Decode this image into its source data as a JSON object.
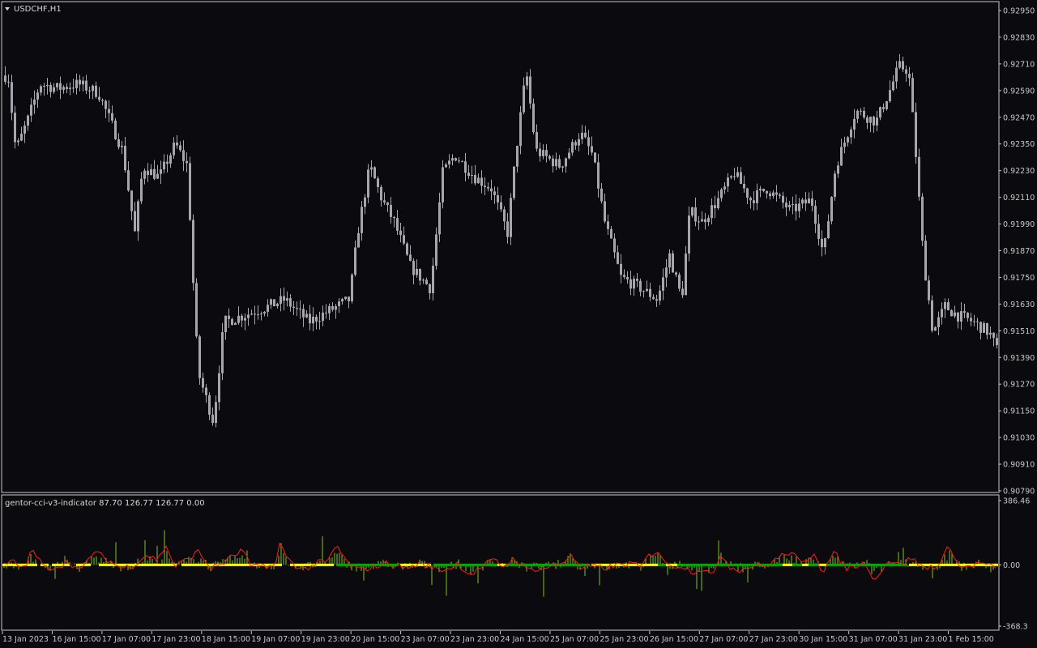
{
  "symbol_label": "USDCHF,H1",
  "indicator_label": "gentor-cci-v3-indicator 87.70 126.77 126.77 0.00",
  "colors": {
    "background": "#0b0b0f",
    "frame": "#c8c8c8",
    "candle": "#a6a6ac",
    "bullish_hist": "#7fc31c",
    "cci_line": "#ff1a1a",
    "trend_up": "#00aa00",
    "trend_down": "#ffff00",
    "axis_text": "#c8c8c8"
  },
  "chart_data": [
    {
      "type": "candlestick",
      "title": "USDCHF,H1",
      "ylim": [
        0.9079,
        0.9295
      ],
      "y_ticks": [
        "0.92950",
        "0.92830",
        "0.92710",
        "0.92590",
        "0.92470",
        "0.92350",
        "0.92230",
        "0.92110",
        "0.91990",
        "0.91870",
        "0.91750",
        "0.91630",
        "0.91510",
        "0.91390",
        "0.91270",
        "0.91150",
        "0.91030",
        "0.90910",
        "0.90790"
      ],
      "x_ticks": [
        "13 Jan 2023",
        "16 Jan 15:00",
        "17 Jan 07:00",
        "17 Jan 23:00",
        "18 Jan 15:00",
        "19 Jan 07:00",
        "19 Jan 23:00",
        "20 Jan 15:00",
        "23 Jan 07:00",
        "23 Jan 23:00",
        "24 Jan 15:00",
        "25 Jan 07:00",
        "25 Jan 23:00",
        "26 Jan 15:00",
        "27 Jan 07:00",
        "27 Jan 23:00",
        "30 Jan 15:00",
        "31 Jan 07:00",
        "31 Jan 23:00",
        "1 Feb 15:00"
      ],
      "close_path": [
        [
          0,
          0.9262
        ],
        [
          8,
          0.9268
        ],
        [
          18,
          0.9232
        ],
        [
          32,
          0.9245
        ],
        [
          48,
          0.9262
        ],
        [
          70,
          0.926
        ],
        [
          95,
          0.9262
        ],
        [
          120,
          0.9258
        ],
        [
          135,
          0.9245
        ],
        [
          150,
          0.9232
        ],
        [
          165,
          0.9195
        ],
        [
          175,
          0.9225
        ],
        [
          195,
          0.922
        ],
        [
          215,
          0.9235
        ],
        [
          230,
          0.9225
        ],
        [
          240,
          0.915
        ],
        [
          245,
          0.913
        ],
        [
          262,
          0.911
        ],
        [
          275,
          0.9155
        ],
        [
          300,
          0.9158
        ],
        [
          330,
          0.9162
        ],
        [
          350,
          0.9165
        ],
        [
          380,
          0.9155
        ],
        [
          405,
          0.916
        ],
        [
          430,
          0.9165
        ],
        [
          440,
          0.9195
        ],
        [
          455,
          0.9225
        ],
        [
          470,
          0.921
        ],
        [
          485,
          0.92
        ],
        [
          505,
          0.918
        ],
        [
          530,
          0.917
        ],
        [
          545,
          0.9222
        ],
        [
          560,
          0.923
        ],
        [
          585,
          0.922
        ],
        [
          605,
          0.9215
        ],
        [
          625,
          0.9195
        ],
        [
          635,
          0.923
        ],
        [
          648,
          0.9268
        ],
        [
          660,
          0.9232
        ],
        [
          690,
          0.9225
        ],
        [
          715,
          0.924
        ],
        [
          730,
          0.923
        ],
        [
          745,
          0.92
        ],
        [
          765,
          0.9175
        ],
        [
          790,
          0.917
        ],
        [
          810,
          0.9165
        ],
        [
          825,
          0.9185
        ],
        [
          840,
          0.9165
        ],
        [
          850,
          0.9205
        ],
        [
          865,
          0.92
        ],
        [
          885,
          0.921
        ],
        [
          905,
          0.9222
        ],
        [
          925,
          0.921
        ],
        [
          945,
          0.9215
        ],
        [
          975,
          0.9205
        ],
        [
          1000,
          0.921
        ],
        [
          1015,
          0.9185
        ],
        [
          1030,
          0.9225
        ],
        [
          1055,
          0.925
        ],
        [
          1080,
          0.9245
        ],
        [
          1098,
          0.926
        ],
        [
          1108,
          0.927
        ],
        [
          1120,
          0.9268
        ],
        [
          1128,
          0.9235
        ],
        [
          1138,
          0.9185
        ],
        [
          1150,
          0.915
        ],
        [
          1165,
          0.9162
        ],
        [
          1180,
          0.9158
        ],
        [
          1200,
          0.9155
        ],
        [
          1220,
          0.915
        ],
        [
          1232,
          0.914
        ]
      ]
    },
    {
      "type": "bar",
      "title": "gentor-cci-v3-indicator 87.70 126.77 126.77 0.00",
      "ylim": [
        -368.3,
        386.46
      ],
      "y_ticks": [
        "386.46",
        "0.00",
        "-368.3"
      ],
      "cci_path": [
        [
          0,
          -10
        ],
        [
          15,
          20
        ],
        [
          30,
          -20
        ],
        [
          40,
          90
        ],
        [
          55,
          -20
        ],
        [
          70,
          -10
        ],
        [
          85,
          20
        ],
        [
          100,
          -40
        ],
        [
          115,
          80
        ],
        [
          130,
          40
        ],
        [
          150,
          -20
        ],
        [
          165,
          0
        ],
        [
          180,
          60
        ],
        [
          195,
          30
        ],
        [
          205,
          120
        ],
        [
          215,
          -10
        ],
        [
          230,
          30
        ],
        [
          245,
          80
        ],
        [
          260,
          -20
        ],
        [
          275,
          10
        ],
        [
          290,
          60
        ],
        [
          300,
          90
        ],
        [
          310,
          -20
        ],
        [
          325,
          0
        ],
        [
          340,
          -10
        ],
        [
          345,
          120
        ],
        [
          360,
          10
        ],
        [
          375,
          -30
        ],
        [
          390,
          10
        ],
        [
          405,
          20
        ],
        [
          415,
          120
        ],
        [
          430,
          0
        ],
        [
          445,
          -30
        ],
        [
          460,
          -10
        ],
        [
          480,
          10
        ],
        [
          500,
          -20
        ],
        [
          520,
          10
        ],
        [
          535,
          -20
        ],
        [
          550,
          -30
        ],
        [
          565,
          10
        ],
        [
          580,
          -60
        ],
        [
          595,
          -10
        ],
        [
          610,
          30
        ],
        [
          620,
          -10
        ],
        [
          635,
          40
        ],
        [
          650,
          -30
        ],
        [
          665,
          -20
        ],
        [
          680,
          -10
        ],
        [
          695,
          10
        ],
        [
          705,
          70
        ],
        [
          715,
          -20
        ],
        [
          730,
          -10
        ],
        [
          745,
          -20
        ],
        [
          765,
          0
        ],
        [
          780,
          10
        ],
        [
          790,
          -20
        ],
        [
          800,
          50
        ],
        [
          812,
          90
        ],
        [
          825,
          -10
        ],
        [
          840,
          0
        ],
        [
          855,
          -40
        ],
        [
          870,
          -20
        ],
        [
          880,
          -80
        ],
        [
          890,
          80
        ],
        [
          900,
          -10
        ],
        [
          915,
          -30
        ],
        [
          930,
          0
        ],
        [
          945,
          -10
        ],
        [
          960,
          40
        ],
        [
          975,
          80
        ],
        [
          990,
          0
        ],
        [
          1005,
          80
        ],
        [
          1015,
          -40
        ],
        [
          1030,
          70
        ],
        [
          1045,
          -20
        ],
        [
          1060,
          0
        ],
        [
          1070,
          10
        ],
        [
          1080,
          -100
        ],
        [
          1095,
          30
        ],
        [
          1110,
          0
        ],
        [
          1125,
          40
        ],
        [
          1140,
          -20
        ],
        [
          1160,
          0
        ],
        [
          1172,
          120
        ],
        [
          1185,
          -20
        ],
        [
          1200,
          0
        ],
        [
          1215,
          10
        ],
        [
          1230,
          -30
        ]
      ],
      "trend_segments": [
        {
          "from": 3,
          "to": 46,
          "state": "down"
        },
        {
          "from": 50,
          "to": 60,
          "state": "down"
        },
        {
          "from": 64,
          "to": 86,
          "state": "down"
        },
        {
          "from": 94,
          "to": 112,
          "state": "down"
        },
        {
          "from": 122,
          "to": 218,
          "state": "down"
        },
        {
          "from": 224,
          "to": 348,
          "state": "down"
        },
        {
          "from": 358,
          "to": 412,
          "state": "down"
        },
        {
          "from": 415,
          "to": 492,
          "state": "up"
        },
        {
          "from": 494,
          "to": 532,
          "state": "down"
        },
        {
          "from": 535,
          "to": 614,
          "state": "up"
        },
        {
          "from": 614,
          "to": 624,
          "state": "down"
        },
        {
          "from": 624,
          "to": 728,
          "state": "up"
        },
        {
          "from": 730,
          "to": 812,
          "state": "down"
        },
        {
          "from": 812,
          "to": 822,
          "state": "up"
        },
        {
          "from": 822,
          "to": 836,
          "state": "down"
        },
        {
          "from": 836,
          "to": 966,
          "state": "up"
        },
        {
          "from": 966,
          "to": 978,
          "state": "down"
        },
        {
          "from": 978,
          "to": 990,
          "state": "up"
        },
        {
          "from": 990,
          "to": 998,
          "state": "down"
        },
        {
          "from": 998,
          "to": 1010,
          "state": "up"
        },
        {
          "from": 1010,
          "to": 1020,
          "state": "down"
        },
        {
          "from": 1020,
          "to": 1120,
          "state": "up"
        },
        {
          "from": 1122,
          "to": 1232,
          "state": "down"
        }
      ]
    }
  ]
}
